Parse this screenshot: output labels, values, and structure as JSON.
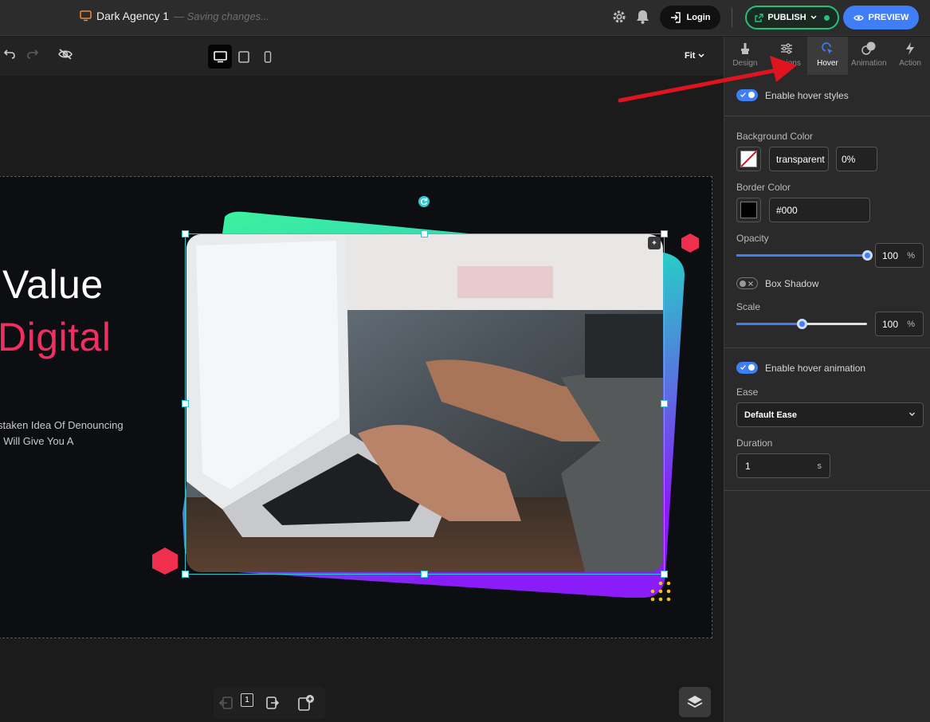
{
  "app": {
    "doc_name": "Dark Agency 1",
    "saving_status": "— Saving changes...",
    "login_label": "Login",
    "publish_label": "PUBLISH",
    "preview_label": "PREVIEW"
  },
  "toolbar": {
    "zoom_label": "Fit",
    "devices": [
      "desktop",
      "tablet",
      "mobile"
    ],
    "active_device": "desktop"
  },
  "canvas": {
    "hero_line1": "Value",
    "hero_line2": "Digital",
    "hero_body_line1": "staken Idea Of Denouncing",
    "hero_body_line2": "I Will Give You A",
    "page_number": "1"
  },
  "panel": {
    "tabs": [
      {
        "label": "Design",
        "icon": "brush-icon"
      },
      {
        "label": "Options",
        "icon": "sliders-icon"
      },
      {
        "label": "Hover",
        "icon": "cursor-icon"
      },
      {
        "label": "Animation",
        "icon": "animation-icon"
      },
      {
        "label": "Action",
        "icon": "bolt-icon"
      }
    ],
    "options_tab_visible": "ions",
    "active_tab": "Hover",
    "enable_hover_styles": "Enable hover styles",
    "background_color_label": "Background Color",
    "background_color_value": "transparent",
    "background_opacity": "0%",
    "border_color_label": "Border Color",
    "border_color_value": "#000",
    "opacity_label": "Opacity",
    "opacity_value": "100",
    "opacity_unit": "%",
    "opacity_level": 1.0,
    "box_shadow_label": "Box Shadow",
    "scale_label": "Scale",
    "scale_value": "100",
    "scale_unit": "%",
    "scale_level": 0.5,
    "enable_hover_animation": "Enable hover animation",
    "ease_label": "Ease",
    "ease_value": "Default Ease",
    "duration_label": "Duration",
    "duration_value": "1",
    "duration_unit": "s"
  },
  "colors": {
    "accent_blue": "#3f7ef5",
    "publish_green": "#1fc37a",
    "hero_pink": "#f02f61",
    "selection_cyan": "#2ec7d6",
    "arrow_red": "#e0141e"
  }
}
